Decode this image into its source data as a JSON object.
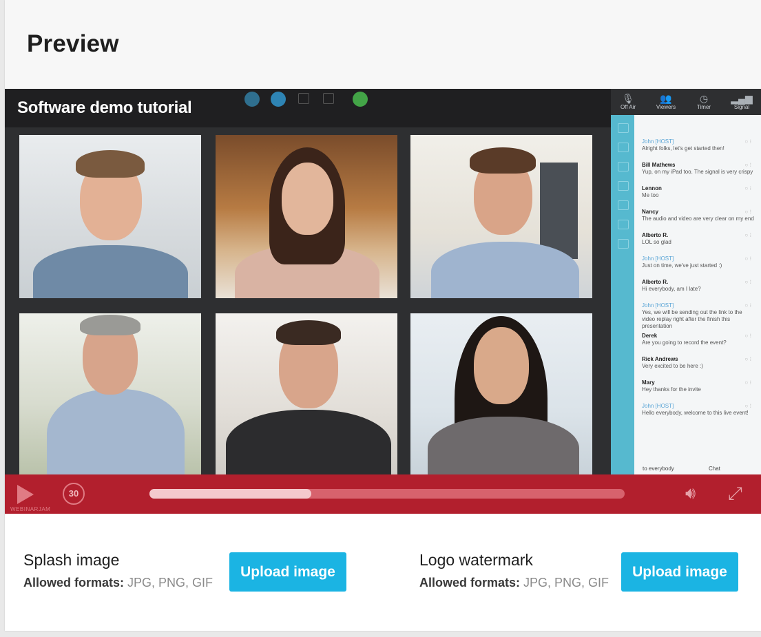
{
  "header": {
    "title": "Preview"
  },
  "player": {
    "video_title": "Software demo tutorial",
    "rewind_label": "30",
    "progress": 0.34,
    "brand": "WEBINARJAM",
    "status": [
      {
        "label": "Off Air",
        "icon": "mic-icon"
      },
      {
        "label": "Viewers",
        "icon": "people-icon"
      },
      {
        "label": "Timer",
        "icon": "clock-icon"
      },
      {
        "label": "Signal",
        "icon": "signal-icon"
      }
    ],
    "accent": "#b21f2d",
    "chat_accent": "#56b9cf"
  },
  "chat": {
    "messages": [
      {
        "name": "John [HOST]",
        "host": true,
        "text": "Alright folks, let's get started then!"
      },
      {
        "name": "Bill Mathews",
        "host": false,
        "text": "Yup, on my iPad too. The signal is very crispy"
      },
      {
        "name": "Lennon",
        "host": false,
        "text": "Me too"
      },
      {
        "name": "Nancy",
        "host": false,
        "text": "The audio and video are very clear on my end"
      },
      {
        "name": "Alberto R.",
        "host": false,
        "text": "LOL so glad"
      },
      {
        "name": "John [HOST]",
        "host": true,
        "text": "Just on time, we've just started :)"
      },
      {
        "name": "Alberto R.",
        "host": false,
        "text": "Hi everybody, am I late?"
      },
      {
        "name": "John [HOST]",
        "host": true,
        "text": "Yes, we will be sending out the link to the video replay right after the finish this presentation"
      },
      {
        "name": "Derek",
        "host": false,
        "text": "Are you going to record the event?"
      },
      {
        "name": "Rick Andrews",
        "host": false,
        "text": "Very excited to be here :)"
      },
      {
        "name": "Mary",
        "host": false,
        "text": "Hey thanks for the invite"
      },
      {
        "name": "John [HOST]",
        "host": true,
        "text": "Hello everybody, welcome to this live event!"
      }
    ],
    "footer_to": "to everybody",
    "footer_mode": "Chat"
  },
  "uploads": [
    {
      "title": "Splash image",
      "formats_label": "Allowed formats:",
      "formats": "JPG, PNG, GIF",
      "button": "Upload image"
    },
    {
      "title": "Logo watermark",
      "formats_label": "Allowed formats:",
      "formats": "JPG, PNG, GIF",
      "button": "Upload image"
    }
  ]
}
